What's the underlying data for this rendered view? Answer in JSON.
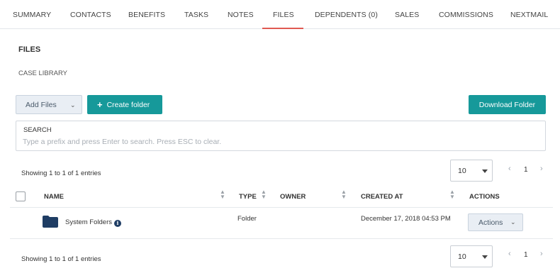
{
  "tabs": [
    {
      "label": "SUMMARY"
    },
    {
      "label": "CONTACTS"
    },
    {
      "label": "BENEFITS"
    },
    {
      "label": "TASKS"
    },
    {
      "label": "NOTES"
    },
    {
      "label": "FILES",
      "active": true
    },
    {
      "label": "DEPENDENTS (0)"
    },
    {
      "label": "SALES"
    },
    {
      "label": "COMMISSIONS"
    },
    {
      "label": "NEXTMAIL"
    }
  ],
  "page": {
    "title": "FILES",
    "breadcrumb": "CASE LIBRARY"
  },
  "toolbar": {
    "add_files_label": "Add Files",
    "add_files_caret": "⌄",
    "create_folder_label": "Create folder",
    "download_folder_label": "Download Folder"
  },
  "search": {
    "label": "SEARCH",
    "placeholder": "Type a prefix and press Enter to search. Press ESC to clear.",
    "value": ""
  },
  "pagination_top": {
    "summary": "Showing 1 to 1 of 1 entries",
    "page_size": "10",
    "prev": "‹",
    "current_page": "1",
    "next": "›"
  },
  "table": {
    "columns": [
      "NAME",
      "TYPE",
      "OWNER",
      "CREATED AT",
      "ACTIONS"
    ],
    "rows": [
      {
        "name": "System Folders",
        "type": "Folder",
        "owner": "",
        "created_at": "December 17, 2018 04:53 PM",
        "actions_label": "Actions",
        "actions_caret": "⌄"
      }
    ]
  },
  "pagination_bottom": {
    "summary": "Showing 1 to 1 of 1 entries",
    "page_size": "10",
    "prev": "‹",
    "current_page": "1",
    "next": "›"
  },
  "colors": {
    "accent": "#16999a",
    "active_tab_underline": "#e05a52",
    "folder_icon": "#1f3d64"
  }
}
